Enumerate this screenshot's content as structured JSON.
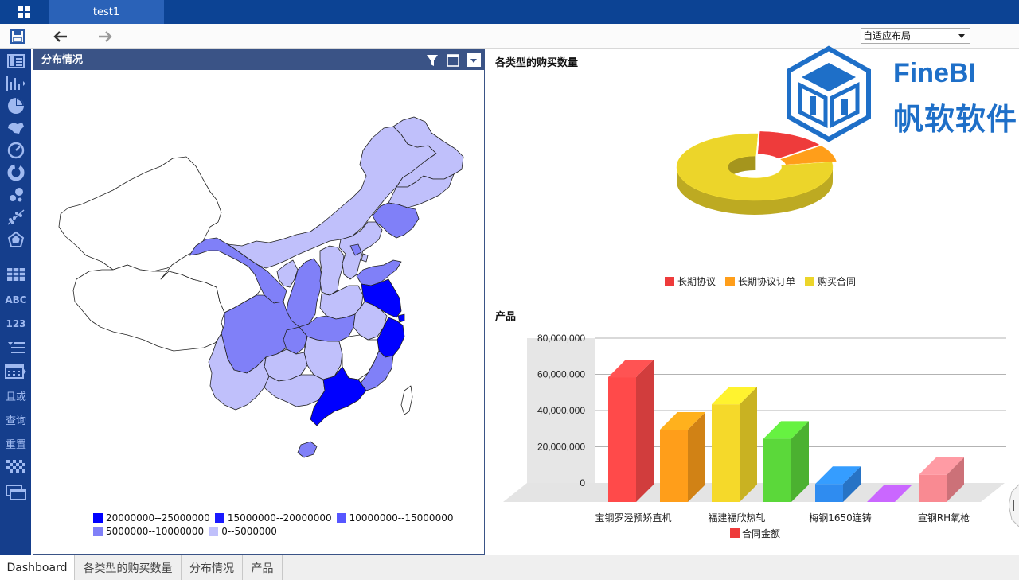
{
  "window": {
    "tab_title": "test1"
  },
  "toolbar": {
    "layout_select_value": "自适应布局"
  },
  "sidebar": {
    "items": [
      {
        "icon": "table-layout-icon"
      },
      {
        "icon": "bar-chart-icon"
      },
      {
        "icon": "pie-chart-icon"
      },
      {
        "icon": "map-icon"
      },
      {
        "icon": "gauge-icon"
      },
      {
        "icon": "donut-icon"
      },
      {
        "icon": "bubble-icon"
      },
      {
        "icon": "scatter-icon"
      },
      {
        "icon": "radar-icon"
      },
      {
        "icon": "table-icon"
      },
      {
        "label": "ABC"
      },
      {
        "label": "123"
      },
      {
        "icon": "list-filter-icon"
      },
      {
        "icon": "date-icon"
      },
      {
        "label": "且或"
      },
      {
        "label": "查询"
      },
      {
        "label": "重置"
      },
      {
        "icon": "checkerboard-icon"
      },
      {
        "icon": "window-icon"
      }
    ]
  },
  "map_panel": {
    "title": "分布情况",
    "legend": [
      {
        "label": "20000000--25000000",
        "color": "#0000ff"
      },
      {
        "label": "15000000--20000000",
        "color": "#1a1aff"
      },
      {
        "label": "10000000--15000000",
        "color": "#5656ff"
      },
      {
        "label": "5000000--10000000",
        "color": "#8080f8"
      },
      {
        "label": "0--5000000",
        "color": "#c0c0fb"
      }
    ]
  },
  "pie_panel": {
    "title": "各类型的购买数量",
    "legend": [
      {
        "label": "长期协议",
        "color": "#ee3b3b"
      },
      {
        "label": "长期协议订单",
        "color": "#ff9e1a"
      },
      {
        "label": "购买合同",
        "color": "#ecd52a"
      }
    ]
  },
  "bar_panel": {
    "title": "产品",
    "legend_label": "合同金额",
    "legend_color": "#ee3b3b"
  },
  "logo": {
    "name": "FineBI",
    "company": "帆软软件"
  },
  "chart_data": [
    {
      "type": "pie",
      "title": "各类型的购买数量",
      "categories": [
        "长期协议",
        "长期协议订单",
        "购买合同"
      ],
      "values": [
        14,
        8,
        78
      ],
      "style": "3d-donut"
    },
    {
      "type": "bar",
      "title": "产品",
      "categories": [
        "宝钢罗泾预矫直机",
        "",
        "福建福欣热轧",
        "",
        "梅钢1650连铸",
        "",
        "宣钢RH氧枪"
      ],
      "tick_labels": [
        "0",
        "20,000,000",
        "40,000,000",
        "60,000,000",
        "80,000,000"
      ],
      "ylim": [
        0,
        80000000
      ],
      "series": [
        {
          "name": "合同金额",
          "values": [
            69000000,
            40000000,
            54000000,
            35000000,
            10000000,
            0,
            15000000
          ]
        }
      ],
      "colors": [
        "#ff4a4a",
        "#ff9e1a",
        "#f5d92a",
        "#5bd83a",
        "#2f8cf0",
        "#b45cf5",
        "#f98a92"
      ],
      "style": "3d"
    }
  ],
  "bottom_tabs": [
    "Dashboard",
    "各类型的购买数量",
    "分布情况",
    "产品"
  ]
}
